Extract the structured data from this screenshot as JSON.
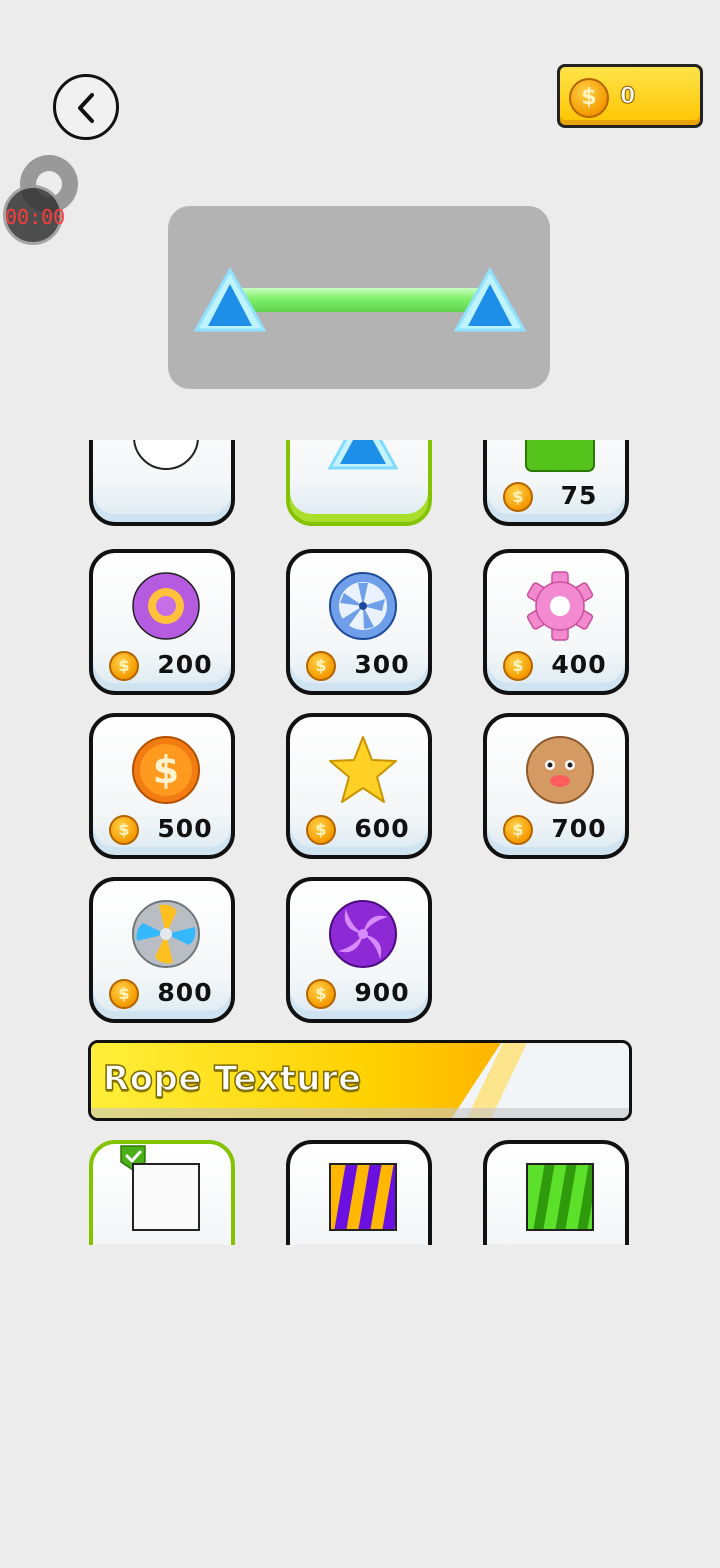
{
  "header": {
    "back_icon": "chevron-left-icon",
    "coin_balance": "0",
    "coin_symbol": "$"
  },
  "recorder": {
    "timer": "00:00"
  },
  "preview": {
    "rope_color": "#7fef6a",
    "end_shape": "triangle"
  },
  "shop": {
    "end_items": [
      {
        "icon": "circle-icon",
        "price": "",
        "selected": false
      },
      {
        "icon": "triangle-icon",
        "price": "",
        "selected": true
      },
      {
        "icon": "green-square-icon",
        "price": "75",
        "selected": false
      },
      {
        "icon": "purple-gear-icon",
        "price": "200",
        "selected": false
      },
      {
        "icon": "blue-wheel-icon",
        "price": "300",
        "selected": false
      },
      {
        "icon": "pink-gear-icon",
        "price": "400",
        "selected": false
      },
      {
        "icon": "dollar-coin-icon",
        "price": "500",
        "selected": false
      },
      {
        "icon": "star-icon",
        "price": "600",
        "selected": false
      },
      {
        "icon": "face-ball-icon",
        "price": "700",
        "selected": false
      },
      {
        "icon": "fan-icon",
        "price": "800",
        "selected": false
      },
      {
        "icon": "swirl-candy-icon",
        "price": "900",
        "selected": false
      }
    ],
    "rope_texture_title": "Rope Texture",
    "texture_items": [
      {
        "icon": "white-texture-icon",
        "selected": true
      },
      {
        "icon": "purple-yellow-stripe-texture-icon",
        "selected": false
      },
      {
        "icon": "green-stripe-texture-icon",
        "selected": false
      }
    ],
    "coin_symbol": "$"
  },
  "colors": {
    "accent_yellow": "#ffd000",
    "selected_green": "#84c300",
    "background": "#ececec"
  }
}
